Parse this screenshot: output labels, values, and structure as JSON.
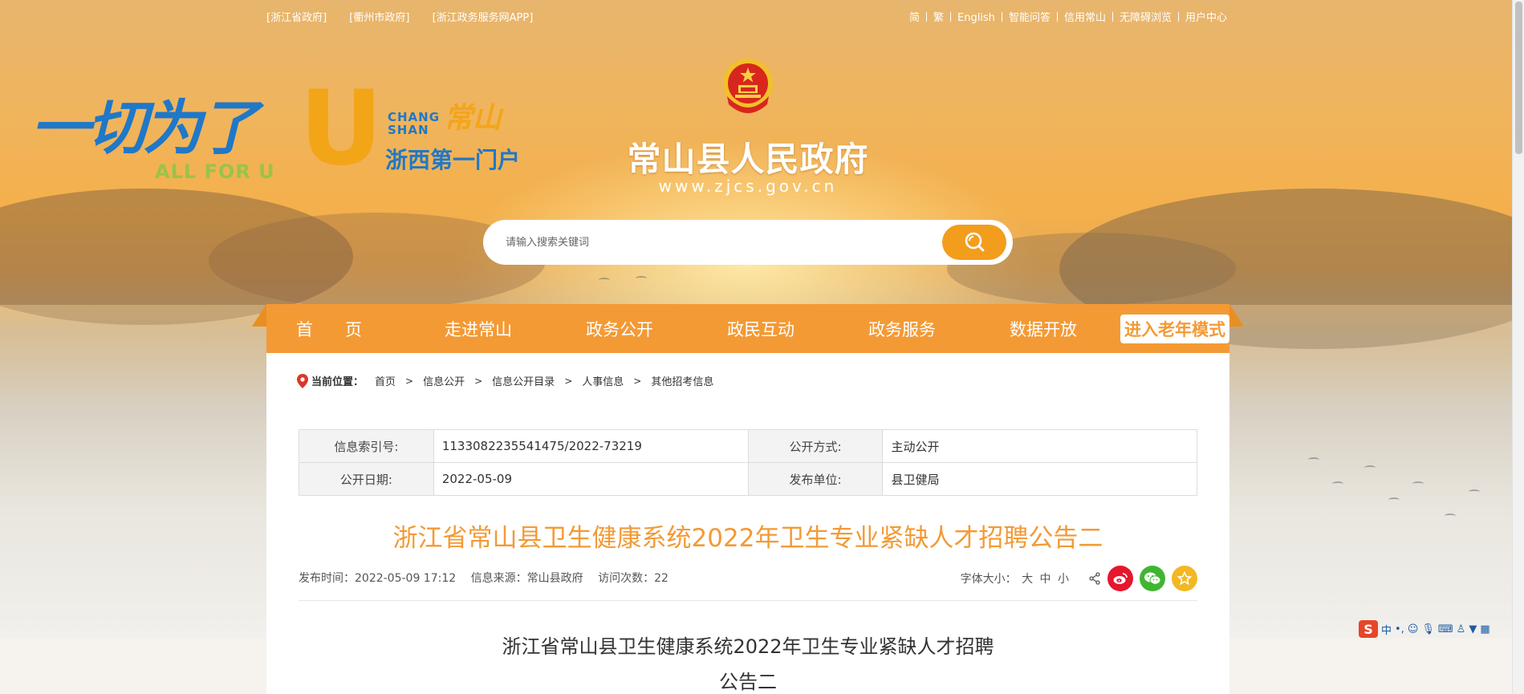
{
  "top_links_left": [
    "[浙江省政府]",
    "[衢州市政府]",
    "[浙江政务服务网APP]"
  ],
  "top_links_right": [
    "简",
    "繁",
    "English",
    "智能问答",
    "信用常山",
    "无障碍浏览",
    "用户中心"
  ],
  "logo": {
    "slogan": "一切为了",
    "slogan_u": "U",
    "slogan_en": "ALL FOR U",
    "chang_shan_1": "CHANG",
    "chang_shan_2": "SHAN",
    "callig": "常山",
    "tagline": "浙西第一门户"
  },
  "site": {
    "title": "常山县人民政府",
    "url": "www.zjcs.gov.cn"
  },
  "search": {
    "placeholder": "请输入搜索关键词",
    "icon": "search-icon"
  },
  "nav": {
    "items": [
      "首页",
      "走进常山",
      "政务公开",
      "政民互动",
      "政务服务",
      "数据开放"
    ],
    "elder_mode": "进入老年模式"
  },
  "breadcrumb": {
    "label": "当前位置：",
    "items": [
      "首页",
      "信息公开",
      "信息公开目录",
      "人事信息",
      "其他招考信息"
    ],
    "separator": ">"
  },
  "info_table": {
    "index_label": "信息索引号:",
    "index_value": "1133082235541475/2022-73219",
    "mode_label": "公开方式:",
    "mode_value": "主动公开",
    "date_label": "公开日期:",
    "date_value": "2022-05-09",
    "unit_label": "发布单位:",
    "unit_value": "县卫健局"
  },
  "article": {
    "title": "浙江省常山县卫生健康系统2022年卫生专业紧缺人才招聘公告二",
    "publish_time": "发布时间：2022-05-09 17:12",
    "source": "信息来源：常山县政府",
    "visits": "访问次数：22",
    "font_size_label": "字体大小：",
    "font_sizes": [
      "大",
      "中",
      "小"
    ],
    "body_title_line1": "浙江省常山县卫生健康系统2022年卫生专业紧缺人才招聘",
    "body_title_line2": "公告二"
  },
  "ime": {
    "logo": "S",
    "mode": "中"
  },
  "colors": {
    "accent": "#f39a35",
    "nav": "#f39a35",
    "brand_blue": "#1f78c8",
    "weibo": "#e6162d",
    "wechat": "#3fb62f",
    "favorite": "#f2b824"
  }
}
